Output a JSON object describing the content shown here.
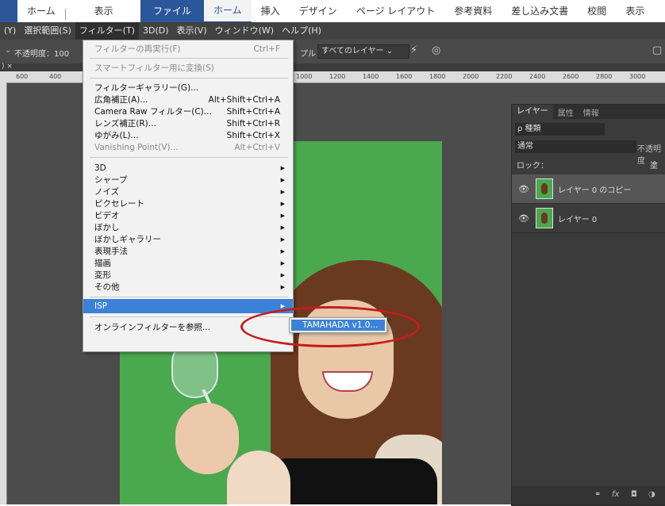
{
  "word_ribbon": {
    "left_tabs": [
      "ホーム",
      "表示"
    ],
    "right_tabs": [
      "ファイル",
      "ホーム",
      "挿入",
      "デザイン",
      "ページ レイアウト",
      "参考資料",
      "差し込み文書",
      "校閲",
      "表示"
    ],
    "accent_color": "#2b579a"
  },
  "ps_menubar": [
    "(Y)",
    "選択範囲(S)",
    "フィルター(T)",
    "3D(D)",
    "表示(V)",
    "ウィンドウ(W)",
    "ヘルプ(H)"
  ],
  "optbar": {
    "opacity_label": "不透明度：100",
    "sample_label": "プル：",
    "layers_dropdown": "すべてのレイヤー",
    "icons": [
      "chevron-down-icon",
      "brush-icon",
      "pressure-icon",
      "workspace-icon"
    ]
  },
  "doc_tab": ")  ×",
  "ruler_ticks": [
    "600",
    "400",
    "1000",
    "1200",
    "1400",
    "1600",
    "1800",
    "2000",
    "2200",
    "2400",
    "2600",
    "2800",
    "3000"
  ],
  "filter_menu": {
    "repeat": {
      "label": "フィルターの再実行(F)",
      "shortcut": "Ctrl+F"
    },
    "smart": "スマートフィルター用に変換(S)",
    "group1": [
      {
        "label": "フィルターギャラリー(G)...",
        "shortcut": "",
        "disabled": false
      },
      {
        "label": "広角補正(A)...",
        "shortcut": "Alt+Shift+Ctrl+A",
        "disabled": false
      },
      {
        "label": "Camera Raw フィルター(C)...",
        "shortcut": "Shift+Ctrl+A",
        "disabled": false
      },
      {
        "label": "レンズ補正(R)...",
        "shortcut": "Shift+Ctrl+R",
        "disabled": false
      },
      {
        "label": "ゆがみ(L)...",
        "shortcut": "Shift+Ctrl+X",
        "disabled": false
      },
      {
        "label": "Vanishing Point(V)...",
        "shortcut": "Alt+Ctrl+V",
        "disabled": true
      }
    ],
    "group2": [
      "3D",
      "シャープ",
      "ノイズ",
      "ピクセレート",
      "ビデオ",
      "ぼかし",
      "ぼかしギャラリー",
      "表現手法",
      "描画",
      "変形",
      "その他"
    ],
    "isp": "ISP",
    "online": "オンラインフィルターを参照..."
  },
  "submenu": {
    "item": "TAMAHADA v1.0..."
  },
  "annotation": {
    "color": "#c71b1b"
  },
  "layers_panel": {
    "tabs": [
      "レイヤー",
      "属性",
      "情報"
    ],
    "kind": "ρ 種類",
    "blend_mode": "通常",
    "opacity_label": "不透明度",
    "lock_label": "ロック：",
    "layers": [
      {
        "name": "レイヤー 0 のコピー",
        "selected": true
      },
      {
        "name": "レイヤー 0",
        "selected": false
      }
    ],
    "footer_icons": [
      "link-icon",
      "fx-icon",
      "mask-icon",
      "adjustment-icon"
    ],
    "fill_label": "塗"
  }
}
